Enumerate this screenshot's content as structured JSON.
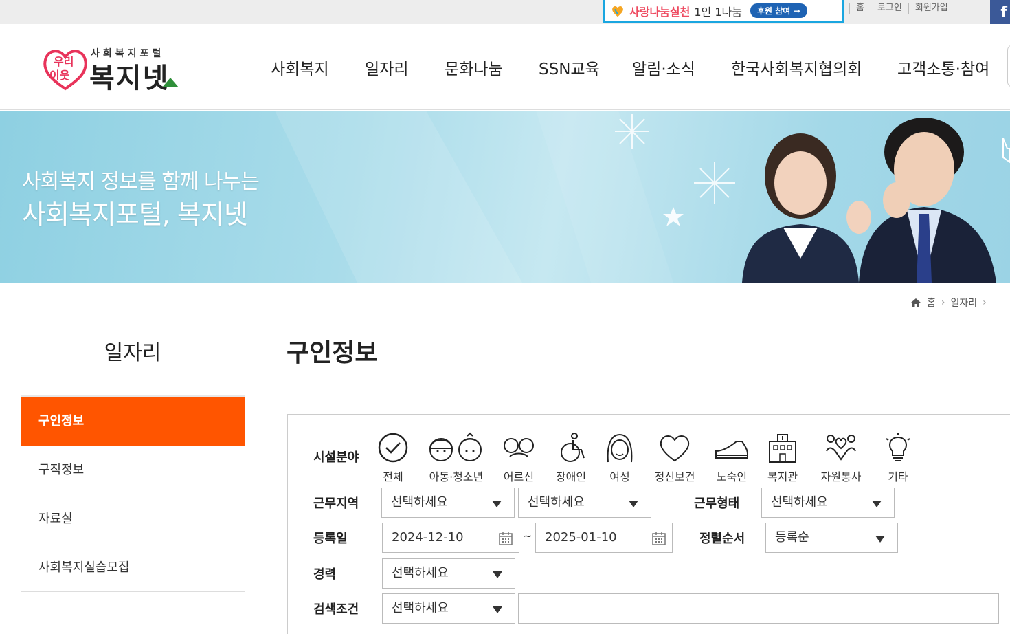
{
  "topbar": {
    "promo_title": "사랑나눔실천",
    "promo_sub": "1인 1나눔",
    "promo_button": "후원 참여 →",
    "links": [
      "홈",
      "로그인",
      "회원가입"
    ],
    "facebook_glyph": "f"
  },
  "header": {
    "logo_small": "사회복지포털",
    "logo_big": "복지넷",
    "logo_badge_top": "우리",
    "logo_badge_bottom": "이웃",
    "gnb": [
      "사회복지",
      "일자리",
      "문화나눔",
      "SSN교육",
      "알림·소식",
      "한국사회복지협의회",
      "고객소통·참여"
    ]
  },
  "banner": {
    "line1": "사회복지 정보를 함께 나누는",
    "line2": "사회복지포털, 복지넷"
  },
  "breadcrumb": {
    "home": "홈",
    "current": "일자리"
  },
  "lnb": {
    "title": "일자리",
    "items": [
      "구인정보",
      "구직정보",
      "자료실",
      "사회복지실습모집"
    ]
  },
  "content": {
    "title": "구인정보"
  },
  "search": {
    "labels": {
      "field": "시설분야",
      "region": "근무지역",
      "work_type": "근무형태",
      "reg_date": "등록일",
      "sort": "정렬순서",
      "career": "경력",
      "condition": "검색조건"
    },
    "categories": [
      {
        "label": "전체",
        "icon": "check-circle-icon"
      },
      {
        "label": "아동·청소년",
        "icon": "children-icon"
      },
      {
        "label": "어르신",
        "icon": "elder-glasses-icon"
      },
      {
        "label": "장애인",
        "icon": "wheelchair-icon"
      },
      {
        "label": "여성",
        "icon": "woman-icon"
      },
      {
        "label": "정신보건",
        "icon": "heart-icon"
      },
      {
        "label": "노숙인",
        "icon": "shoe-icon"
      },
      {
        "label": "복지관",
        "icon": "building-icon"
      },
      {
        "label": "자원봉사",
        "icon": "hands-heart-icon"
      },
      {
        "label": "기타",
        "icon": "lightbulb-icon"
      }
    ],
    "region1": "선택하세요",
    "region2": "선택하세요",
    "work_type": "선택하세요",
    "date_from": "2024-12-10",
    "date_to": "2025-01-10",
    "tilde": "~",
    "sort": "등록순",
    "career": "선택하세요",
    "condition": "선택하세요",
    "keyword": ""
  },
  "colors": {
    "accent": "#ff5500",
    "promo_border": "#1aa6e0",
    "facebook": "#3b5998"
  }
}
